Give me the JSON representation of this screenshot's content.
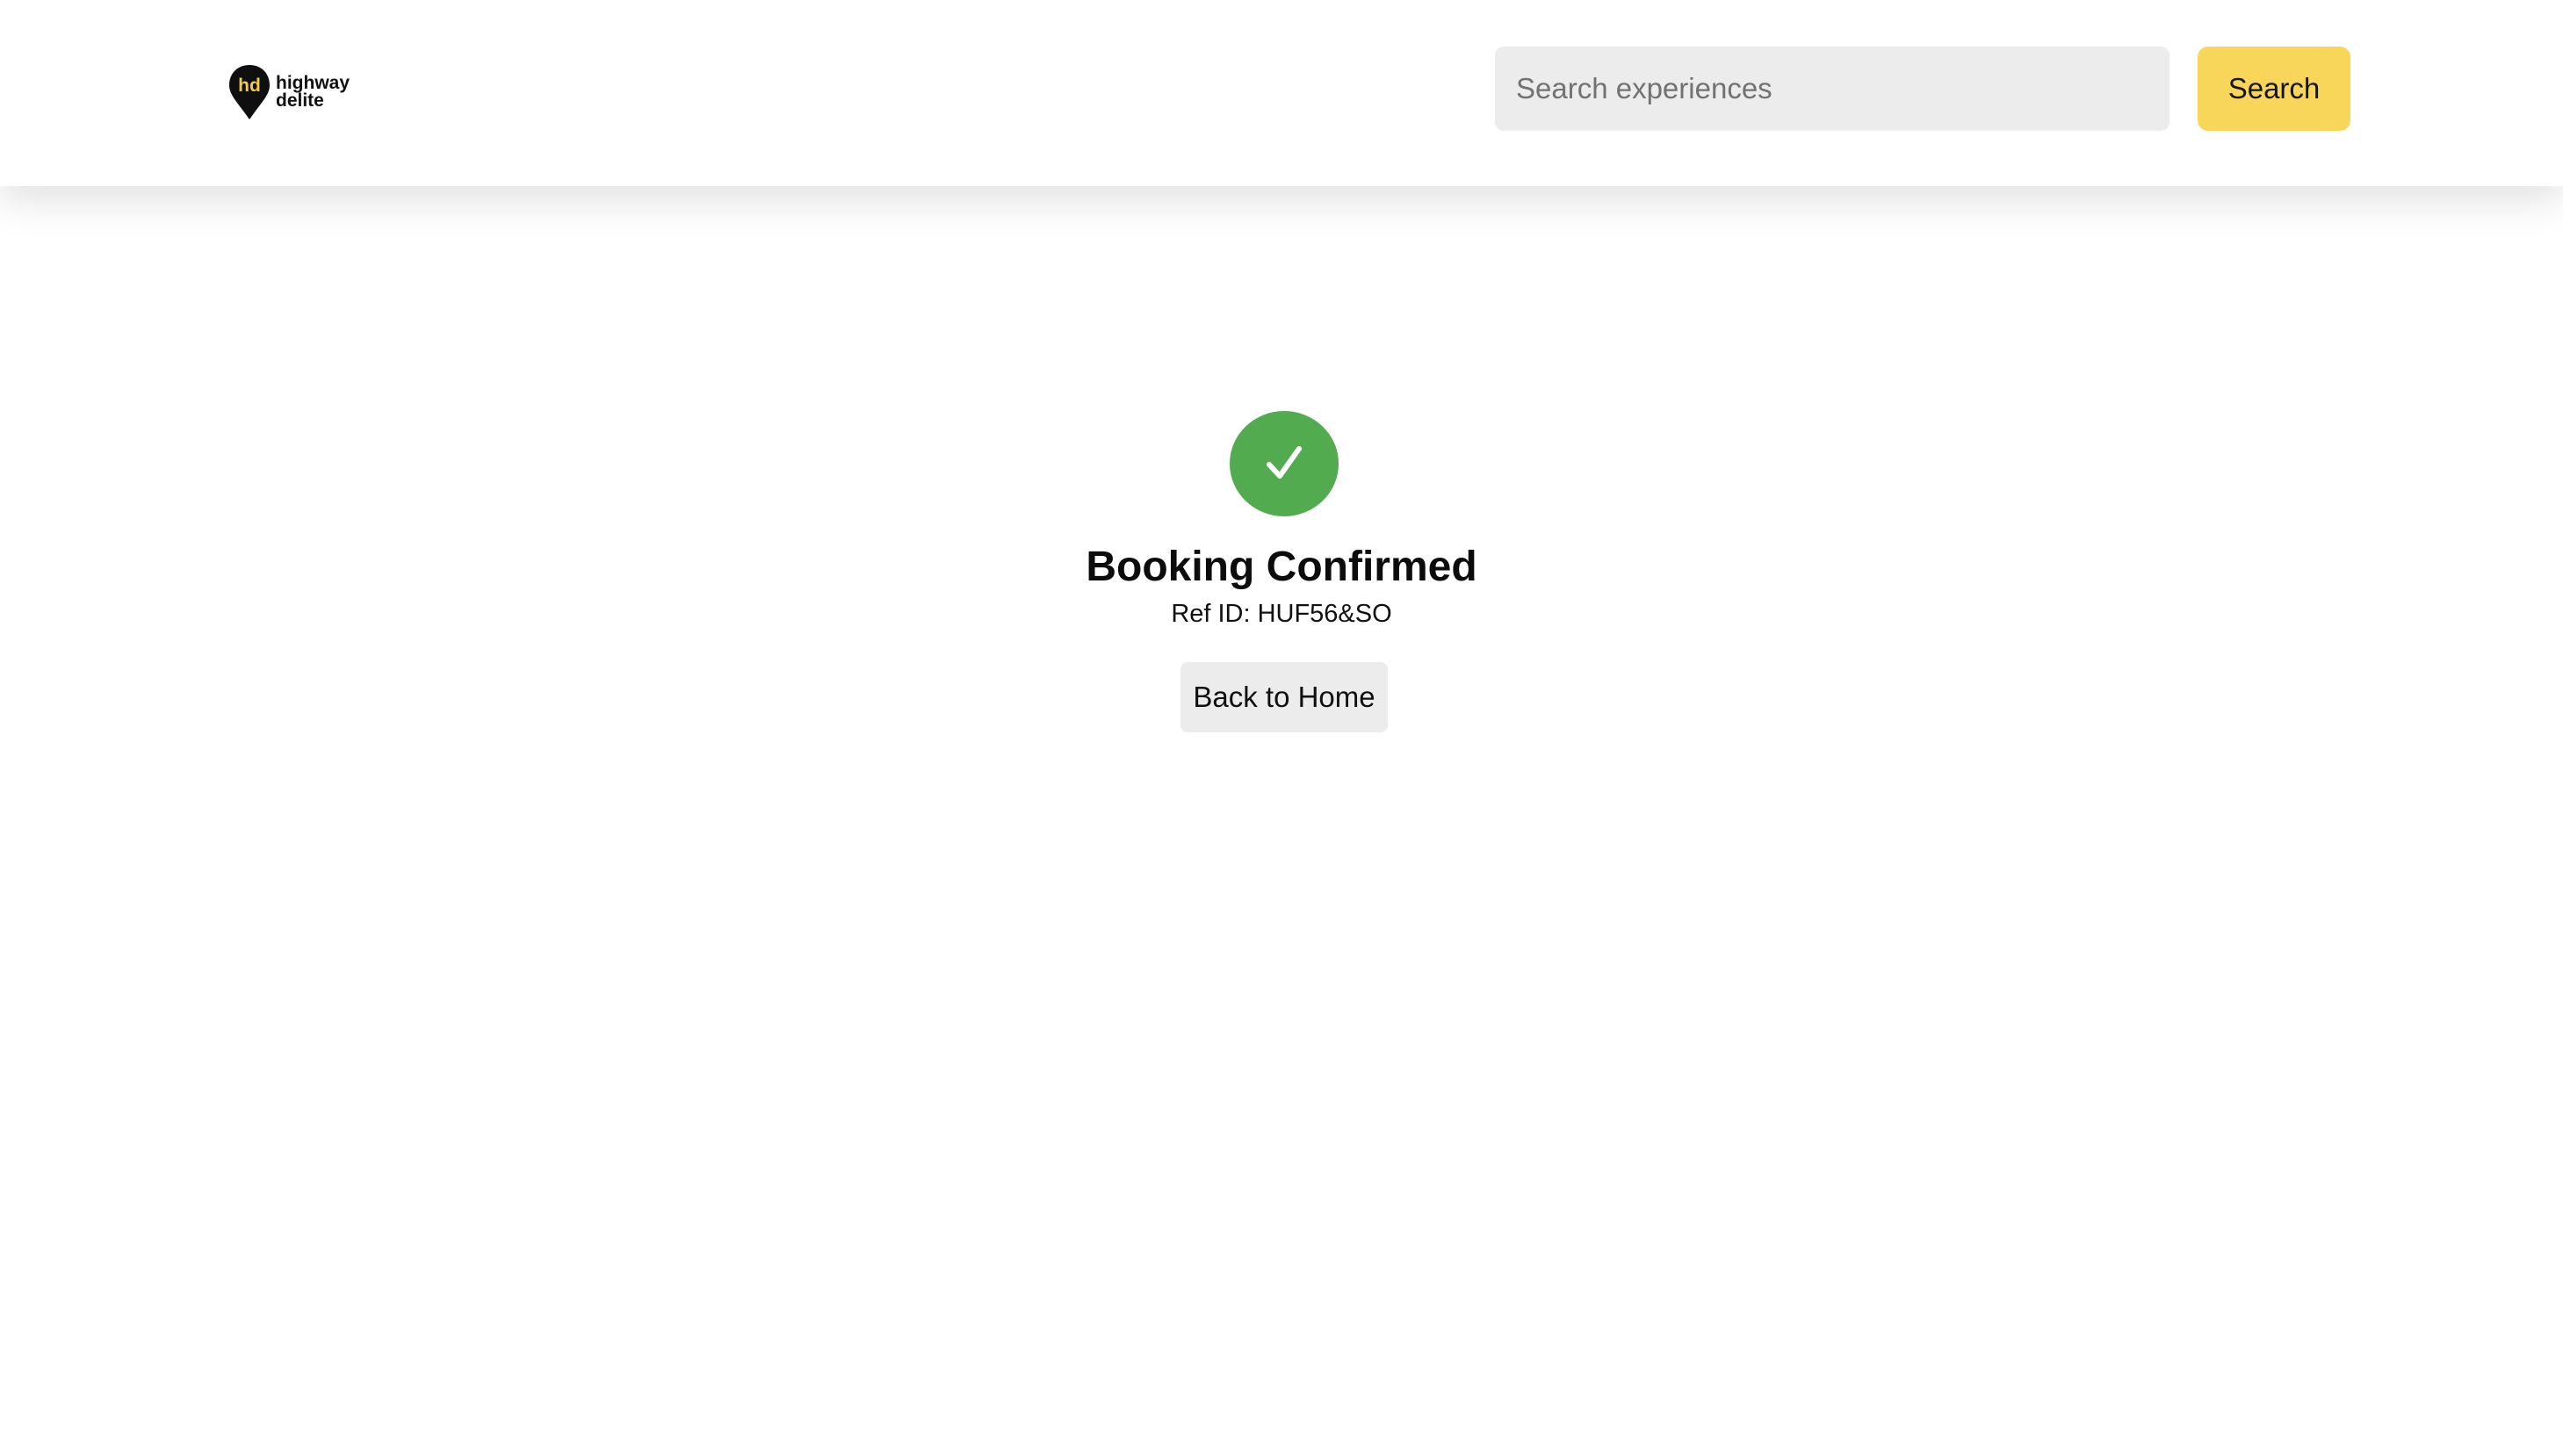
{
  "header": {
    "logo": {
      "monogram": "hd",
      "line1": "highway",
      "line2": "delite",
      "icon": "map-pin-logo-icon"
    },
    "search": {
      "placeholder": "Search experiences",
      "value": "",
      "button_label": "Search"
    }
  },
  "confirmation": {
    "icon": "check-icon",
    "title": "Booking Confirmed",
    "ref_label": "Ref ID:",
    "ref_id": "HUF56&SO",
    "back_button_label": "Back to Home"
  },
  "colors": {
    "accent_yellow": "#f8d65a",
    "success_green": "#52ab4f",
    "input_bg": "#ececec"
  }
}
